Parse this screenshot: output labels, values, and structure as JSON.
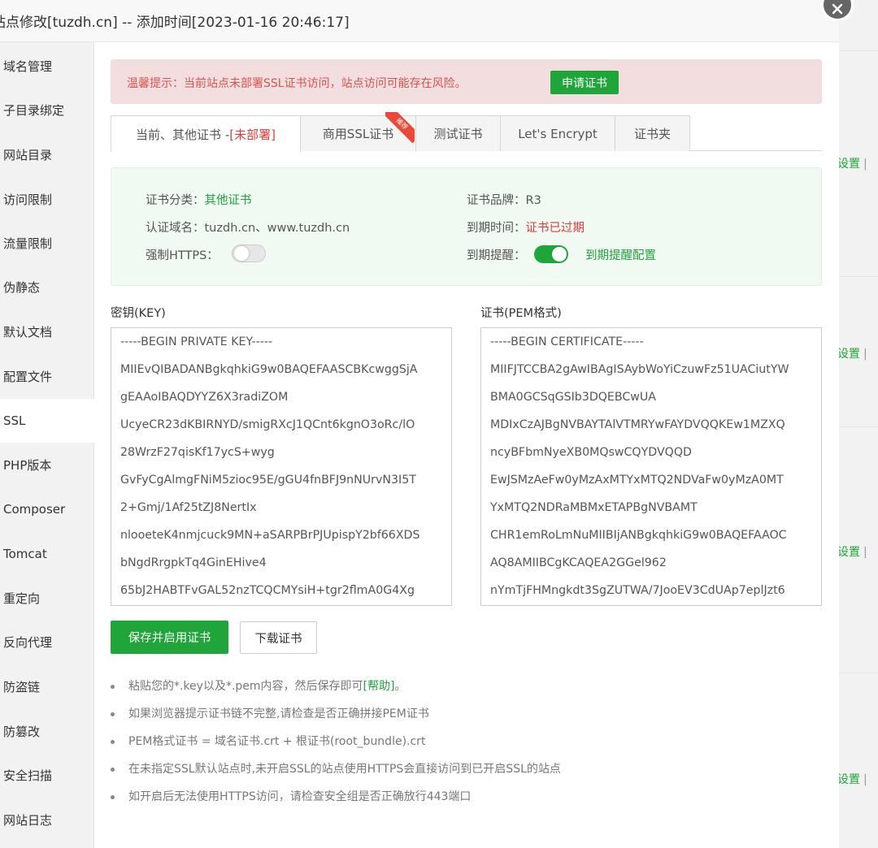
{
  "background": {
    "link_label": "设置",
    "separator": "|"
  },
  "modal": {
    "title": "站点修改[tuzdh.cn] -- 添加时间[2023-01-16 20:46:17]",
    "close_icon": "close-icon"
  },
  "sidebar": {
    "items": [
      {
        "label": "域名管理"
      },
      {
        "label": "子目录绑定"
      },
      {
        "label": "网站目录"
      },
      {
        "label": "访问限制"
      },
      {
        "label": "流量限制"
      },
      {
        "label": "伪静态"
      },
      {
        "label": "默认文档"
      },
      {
        "label": "配置文件"
      },
      {
        "label": "SSL",
        "active": true
      },
      {
        "label": "PHP版本"
      },
      {
        "label": "Composer"
      },
      {
        "label": "Tomcat"
      },
      {
        "label": "重定向"
      },
      {
        "label": "反向代理"
      },
      {
        "label": "防盗链"
      },
      {
        "label": "防篡改"
      },
      {
        "label": "安全扫描"
      },
      {
        "label": "网站日志"
      }
    ]
  },
  "alert": {
    "text": "温馨提示：当前站点未部署SSL证书访问，站点访问可能存在风险。",
    "button": "申请证书"
  },
  "tabs": {
    "current_prefix": "当前、其他证书 - ",
    "current_status": "[未部署]",
    "commercial": "商用SSL证书",
    "ribbon": "推荐",
    "test": "测试证书",
    "letsencrypt": "Let's Encrypt",
    "folder": "证书夹"
  },
  "cert_info": {
    "category_label": "证书分类：",
    "category_value": "其他证书",
    "brand_label": "证书品牌：",
    "brand_value": "R3",
    "domains_label": "认证域名：",
    "domains_value": "tuzdh.cn、www.tuzdh.cn",
    "expiry_label": "到期时间：",
    "expiry_value": "证书已过期",
    "https_label": "强制HTTPS：",
    "https_enabled": false,
    "remind_label": "到期提醒：",
    "remind_enabled": true,
    "remind_link": "到期提醒配置"
  },
  "key_field": {
    "label": "密钥(KEY)",
    "lines": [
      "-----BEGIN PRIVATE KEY-----",
      "MIIEvQIBADANBgkqhkiG9w0BAQEFAASCBKcwggSjA",
      "gEAAoIBAQDYYZ6X3radiZOM",
      "UcyeCR23dKBIRNYD/smigRXcJ1QCnt6kgnO3oRc/lO",
      "28WrzF27qisKf17ycS+wyg",
      "GvFyCgAlmgFNiM5zioc95E/gGU4fnBFJ9nNUrvN3I5T",
      "2+Gmj/1Af25tZJ8NertIx",
      "nlooeteK4nmjcuck9MN+aSARPBrPJUpispY2bf66XDS",
      "bNgdRrgpkTq4GinEHive4",
      "65bJ2HABTFvGAL52nzTCQCMYsiH+tgr2flmA0G4Xg"
    ]
  },
  "cert_field": {
    "label": "证书(PEM格式)",
    "lines": [
      "-----BEGIN CERTIFICATE-----",
      "MIIFJTCCBA2gAwIBAgISAybWoYiCzuwFz51UACiutYW",
      "BMA0GCSqGSIb3DQEBCwUA",
      "MDIxCzAJBgNVBAYTAlVTMRYwFAYDVQQKEw1MZXQ",
      "ncyBFbmNyeXB0MQswCQYDVQQD",
      "EwJSMzAeFw0yMzAxMTYxMTQ2NDVaFw0yMzA0MT",
      "YxMTQ2NDRaMBMxETAPBgNVBAMT",
      "CHR1emRoLmNuMIIBIjANBgkqhkiG9w0BAQEFAAOC",
      "AQ8AMIIBCgKCAQEA2GGel962",
      "nYmTjFHMngkdt3SgZUTWA/7JooEV3CdUAp7eplJzt6"
    ]
  },
  "actions": {
    "save": "保存并启用证书",
    "download": "下载证书"
  },
  "tips": {
    "tip1_text": "粘贴您的*.key以及*.pem内容，然后保存即可",
    "tip1_link": "[帮助]",
    "tip1_end": "。",
    "tip2": "如果浏览器提示证书链不完整,请检查是否正确拼接PEM证书",
    "tip3": "PEM格式证书 = 域名证书.crt + 根证书(root_bundle).crt",
    "tip4": "在未指定SSL默认站点时,未开启SSL的站点使用HTTPS会直接访问到已开启SSL的站点",
    "tip5": "如开启后无法使用HTTPS访问，请检查安全组是否正确放行443端口"
  },
  "colors": {
    "accent": "#20a53a",
    "danger": "#e43b3b",
    "alert_bg": "#f2dede",
    "info_bg": "#f1f9f3"
  }
}
